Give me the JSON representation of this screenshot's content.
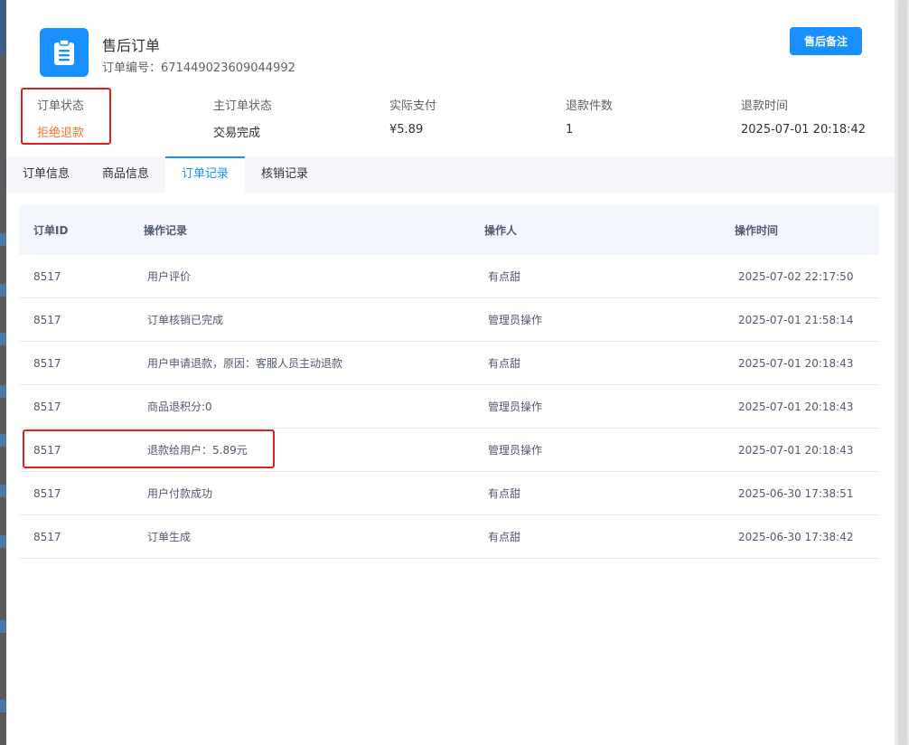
{
  "header": {
    "title": "售后订单",
    "order_no_label": "订单编号：",
    "order_no": "671449023609044992",
    "remark_button": "售后备注"
  },
  "summary": [
    {
      "key": "订单状态",
      "value": "拒绝退款"
    },
    {
      "key": "主订单状态",
      "value": "交易完成"
    },
    {
      "key": "实际支付",
      "value": "¥5.89"
    },
    {
      "key": "退款件数",
      "value": "1"
    },
    {
      "key": "退款时间",
      "value": "2025-07-01 20:18:42"
    }
  ],
  "tabs": [
    {
      "label": "订单信息"
    },
    {
      "label": "商品信息"
    },
    {
      "label": "订单记录"
    },
    {
      "label": "核销记录"
    }
  ],
  "active_tab": "订单记录",
  "table": {
    "headers": [
      "订单ID",
      "操作记录",
      "操作人",
      "操作时间"
    ],
    "rows": [
      [
        "8517",
        "用户评价",
        "有点甜",
        "2025-07-02 22:17:50"
      ],
      [
        "8517",
        "订单核销已完成",
        "管理员操作",
        "2025-07-01 21:58:14"
      ],
      [
        "8517",
        "用户申请退款，原因：客服人员主动退款",
        "有点甜",
        "2025-07-01 20:18:43"
      ],
      [
        "8517",
        "商品退积分:0",
        "管理员操作",
        "2025-07-01 20:18:43"
      ],
      [
        "8517",
        "退款给用户：5.89元",
        "管理员操作",
        "2025-07-01 20:18:43"
      ],
      [
        "8517",
        "用户付款成功",
        "有点甜",
        "2025-06-30 17:38:51"
      ],
      [
        "8517",
        "订单生成",
        "有点甜",
        "2025-06-30 17:38:42"
      ]
    ]
  },
  "colors": {
    "accent": "#1890ff",
    "status_refused": "#f5762d",
    "highlight_box": "#e02020"
  },
  "icons": {
    "header": "clipboard-icon"
  }
}
